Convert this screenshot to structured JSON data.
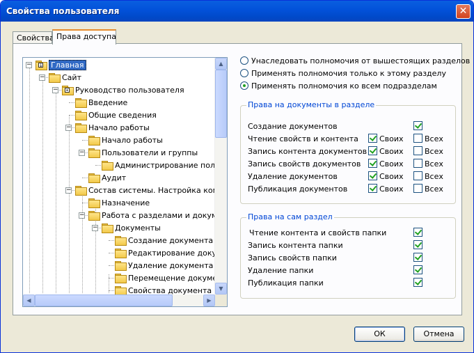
{
  "window": {
    "title": "Свойства пользователя"
  },
  "tabs": [
    {
      "label": "Свойства"
    },
    {
      "label": "Права доступа"
    }
  ],
  "tree": {
    "nodes": [
      {
        "label": "Главная"
      },
      {
        "label": "Сайт"
      },
      {
        "label": "Руководство пользователя"
      },
      {
        "label": "Введение"
      },
      {
        "label": "Общие сведения"
      },
      {
        "label": "Начало работы"
      },
      {
        "label": "Начало работы"
      },
      {
        "label": "Пользователи и группы"
      },
      {
        "label": "Администрирование пользо"
      },
      {
        "label": "Аудит"
      },
      {
        "label": "Состав системы. Настройка компо"
      },
      {
        "label": "Назначение"
      },
      {
        "label": "Работа с разделами и докумен"
      },
      {
        "label": "Документы"
      },
      {
        "label": "Создание документа"
      },
      {
        "label": "Редактирование докум"
      },
      {
        "label": "Удаление документа"
      },
      {
        "label": "Перемещение документ"
      },
      {
        "label": "Свойства документа"
      }
    ]
  },
  "inheritance": {
    "options": [
      {
        "label": "Унаследовать полномочия от вышестоящих разделов",
        "selected": false
      },
      {
        "label": "Применять полномочия только к этому разделу",
        "selected": false
      },
      {
        "label": "Применять полномочия ко всем подразделам",
        "selected": true
      }
    ]
  },
  "doc_rights": {
    "title": "Права на документы в разделе",
    "own_label": "Своих",
    "all_label": "Всех",
    "rows": [
      {
        "label": "Создание документов",
        "checked": true
      },
      {
        "label": "Чтение свойств и контента",
        "own": true,
        "all": false
      },
      {
        "label": "Запись контента документов",
        "own": true,
        "all": false
      },
      {
        "label": "Запись свойств документов",
        "own": true,
        "all": false
      },
      {
        "label": "Удаление документов",
        "own": true,
        "all": false
      },
      {
        "label": "Публикация документов",
        "own": true,
        "all": false
      }
    ]
  },
  "section_rights": {
    "title": "Права на сам раздел",
    "rows": [
      {
        "label": "Чтение контента и свойств папки",
        "checked": true
      },
      {
        "label": "Запись контента папки",
        "checked": true
      },
      {
        "label": "Запись свойств папки",
        "checked": true
      },
      {
        "label": "Удаление папки",
        "checked": true
      },
      {
        "label": "Публикация папки",
        "checked": true
      }
    ]
  },
  "buttons": {
    "ok": "ОК",
    "cancel": "Отмена"
  },
  "icons": {
    "close": "close-icon",
    "folder": "folder-icon",
    "expander": "tree-expander-icon"
  },
  "colors": {
    "titlebar": "#0251d9",
    "selection": "#316ac5",
    "group_title": "#0046d5",
    "check": "#21a121"
  }
}
